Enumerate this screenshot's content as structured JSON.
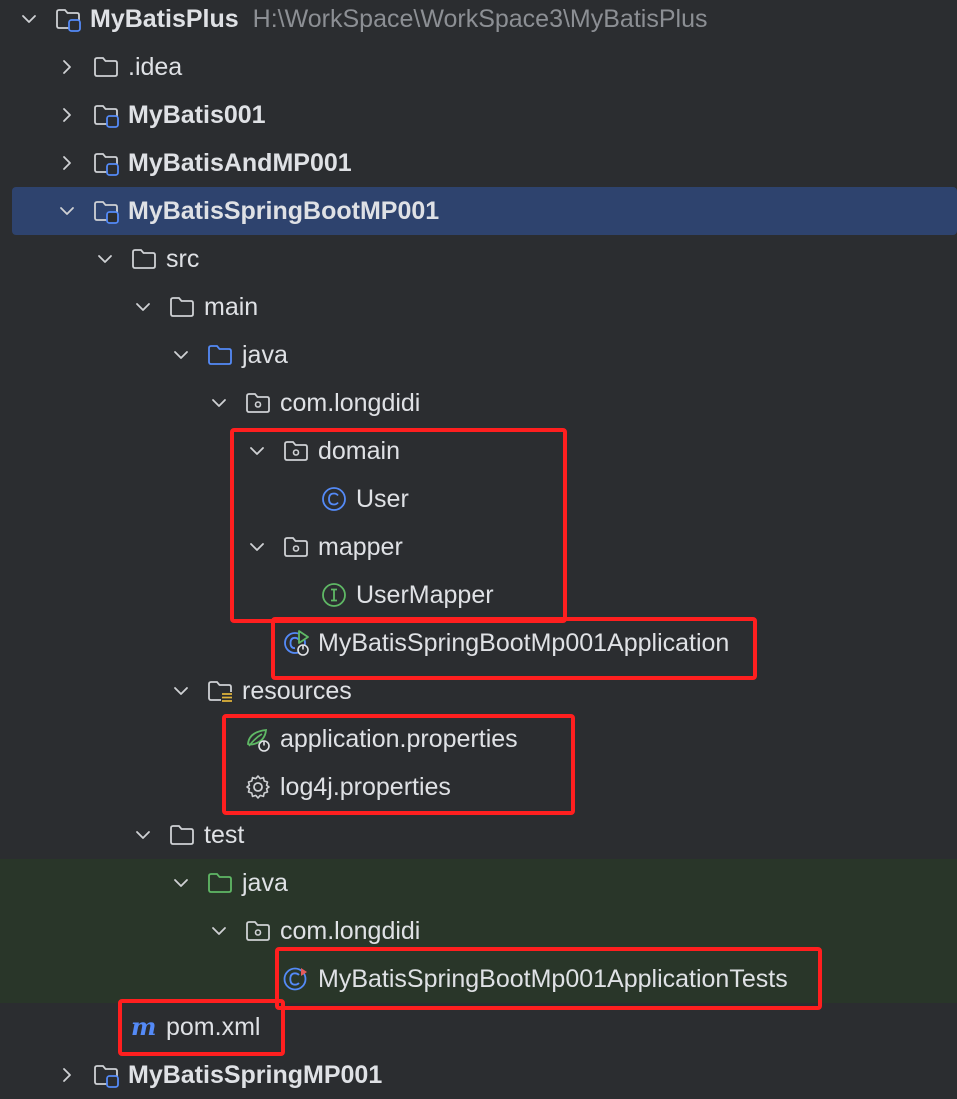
{
  "project": {
    "name": "MyBatisPlus",
    "path": "H:\\WorkSpace\\WorkSpace3\\MyBatisPlus"
  },
  "tree": {
    "idea": ".idea",
    "mybatis001": "MyBatis001",
    "mybatisandmp001": "MyBatisAndMP001",
    "springbootmp001": "MyBatisSpringBootMP001",
    "src": "src",
    "main": "main",
    "main_java": "java",
    "main_pkg": "com.longdidi",
    "domain": "domain",
    "user": "User",
    "mapper": "mapper",
    "usermapper": "UserMapper",
    "application_class": "MyBatisSpringBootMp001Application",
    "resources": "resources",
    "app_props": "application.properties",
    "log4j_props": "log4j.properties",
    "test": "test",
    "test_java": "java",
    "test_pkg": "com.longdidi",
    "tests_class": "MyBatisSpringBootMp001ApplicationTests",
    "pom": "pom.xml",
    "springmp001": "MyBatisSpringMP001"
  },
  "colors": {
    "background": "#2b2d30",
    "selection": "#2e436e",
    "test_background": "#293629",
    "highlight": "#ff1f1f",
    "class_icon": "#548af7",
    "interface_icon": "#5fb865",
    "test_folder": "#5fb865",
    "source_folder": "#548af7"
  },
  "icons": {
    "chevron_right": "chevron-right-icon",
    "chevron_down": "chevron-down-icon",
    "folder": "folder-icon",
    "module": "module-folder-icon",
    "package": "package-icon",
    "class": "class-icon",
    "interface": "interface-icon",
    "spring_boot_app": "spring-boot-app-icon",
    "spring_props": "spring-leaf-icon",
    "settings": "gear-icon",
    "maven": "maven-icon"
  }
}
